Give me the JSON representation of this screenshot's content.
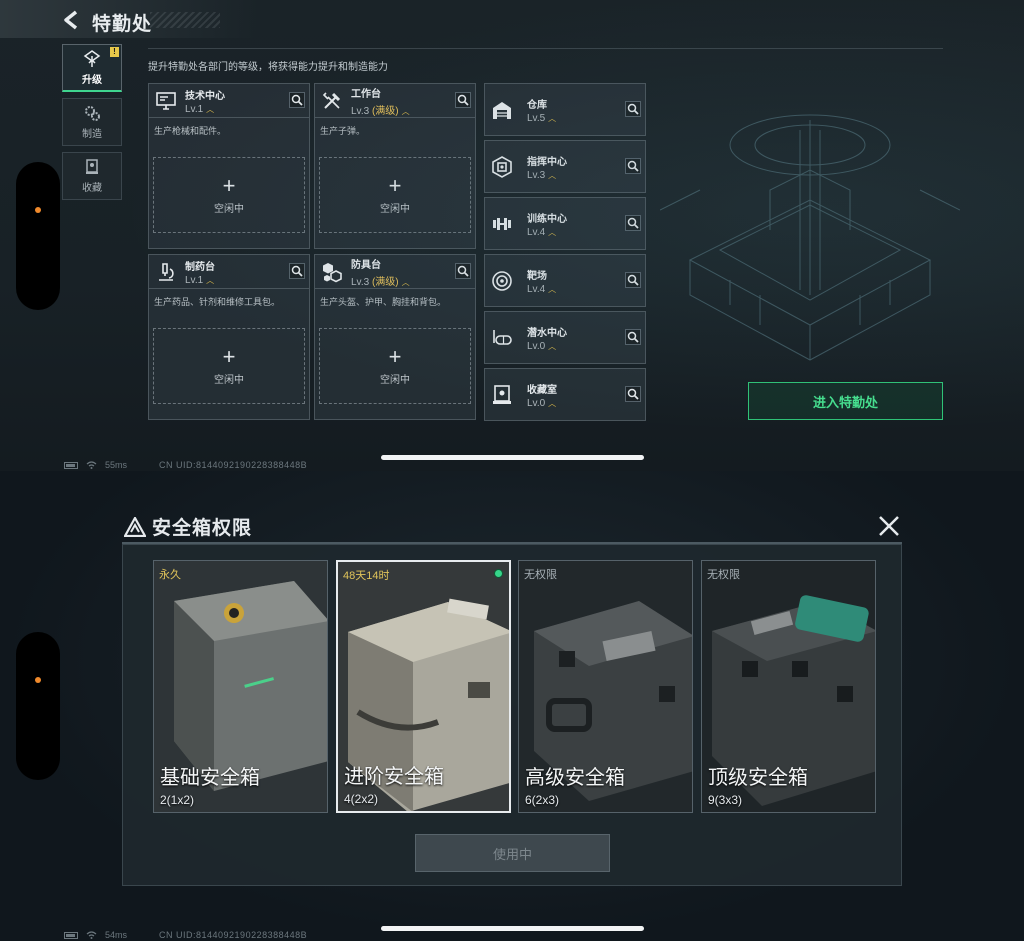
{
  "top": {
    "title": "特勤处",
    "nav": [
      {
        "label": "升级",
        "active": true,
        "badge": "!"
      },
      {
        "label": "制造",
        "active": false
      },
      {
        "label": "收藏",
        "active": false
      }
    ],
    "description": "提升特勤处各部门的等级，将获得能力提升和制造能力",
    "workshops": [
      {
        "name": "技术中心",
        "level": "Lv.1",
        "max": "",
        "desc": "生产枪械和配件。",
        "plus": "+",
        "slot": "空闲中"
      },
      {
        "name": "工作台",
        "level": "Lv.3",
        "max": "(满级)",
        "desc": "生产子弹。",
        "plus": "+",
        "slot": "空闲中"
      },
      {
        "name": "制药台",
        "level": "Lv.1",
        "max": "",
        "desc": "生产药品、针剂和维修工具包。",
        "plus": "+",
        "slot": "空闲中"
      },
      {
        "name": "防具台",
        "level": "Lv.3",
        "max": "(满级)",
        "desc": "生产头盔、护甲、胸挂和背包。",
        "plus": "+",
        "slot": "空闲中"
      }
    ],
    "facilities": [
      {
        "name": "仓库",
        "level": "Lv.5"
      },
      {
        "name": "指挥中心",
        "level": "Lv.3"
      },
      {
        "name": "训练中心",
        "level": "Lv.4"
      },
      {
        "name": "靶场",
        "level": "Lv.4"
      },
      {
        "name": "潜水中心",
        "level": "Lv.0"
      },
      {
        "name": "收藏室",
        "level": "Lv.0"
      }
    ],
    "enter_button": "进入特勤处",
    "status": {
      "ping": "55ms",
      "uid": "CN UID:8144092190228388448B"
    }
  },
  "bottom": {
    "title": "安全箱权限",
    "boxes": [
      {
        "tag": "永久",
        "name": "基础安全箱",
        "size": "2(1x2)",
        "selected": false
      },
      {
        "tag": "48天14时",
        "name": "进阶安全箱",
        "size": "4(2x2)",
        "selected": true
      },
      {
        "tag": "无权限",
        "name": "高级安全箱",
        "size": "6(2x3)",
        "selected": false
      },
      {
        "tag": "无权限",
        "name": "顶级安全箱",
        "size": "9(3x3)",
        "selected": false
      }
    ],
    "use_button": "使用中",
    "status": {
      "ping": "54ms",
      "uid": "CN UID:8144092190228388448B"
    }
  },
  "colors": {
    "accent_green": "#3fd58f",
    "gold": "#e6c15a",
    "tag_gold": "#e0c45a"
  }
}
